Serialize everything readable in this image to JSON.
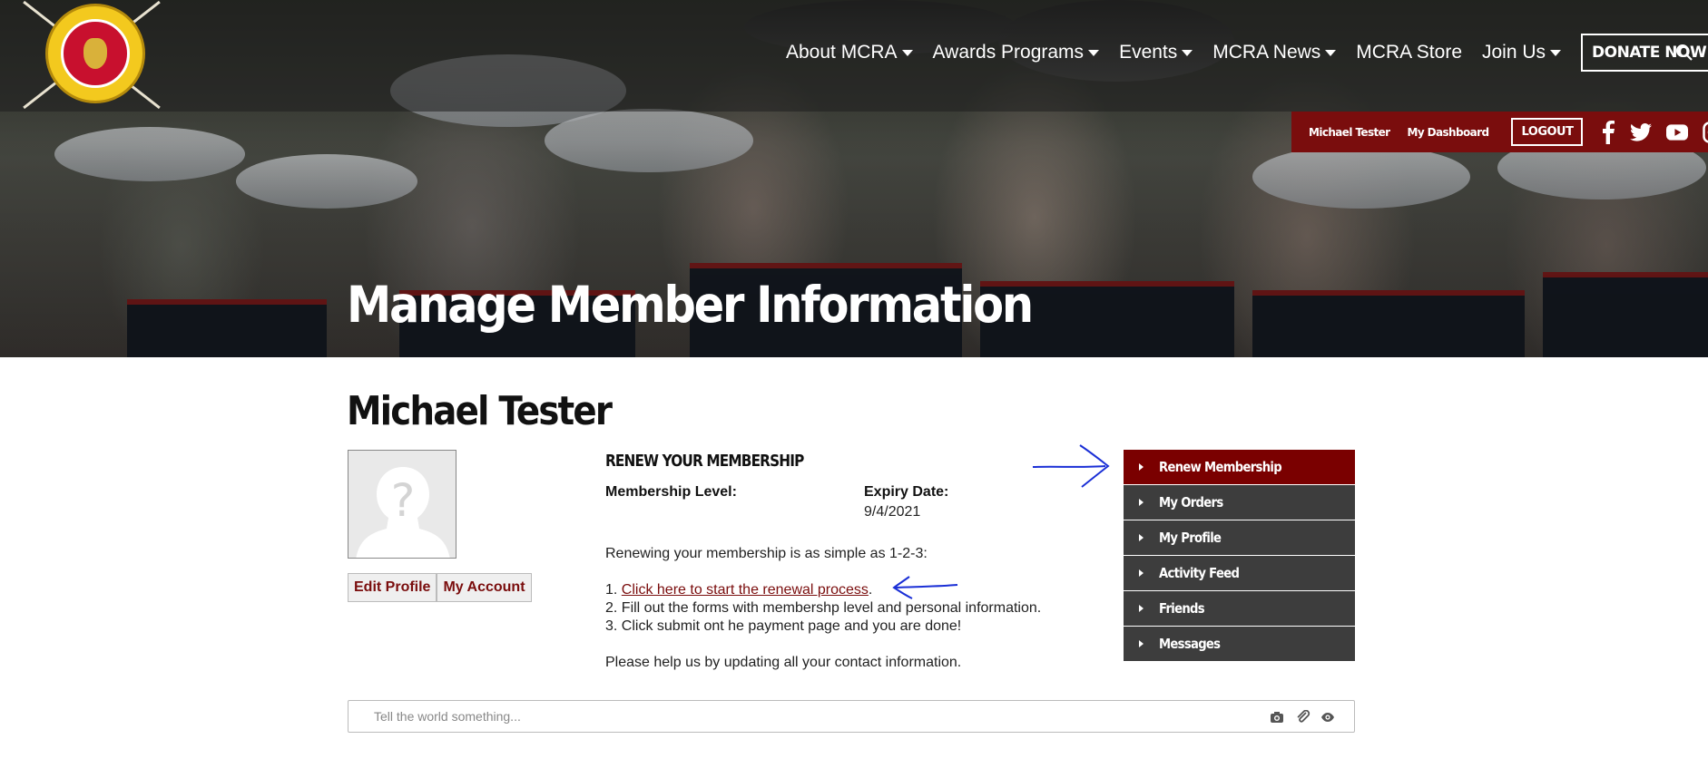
{
  "header": {
    "nav": [
      {
        "label": "About MCRA",
        "has_dropdown": true
      },
      {
        "label": "Awards Programs",
        "has_dropdown": true
      },
      {
        "label": "Events",
        "has_dropdown": true
      },
      {
        "label": "MCRA News",
        "has_dropdown": true
      },
      {
        "label": "MCRA Store",
        "has_dropdown": false
      },
      {
        "label": "Join Us",
        "has_dropdown": true
      }
    ],
    "donate_label": "DONATE NOW",
    "search_icon": "search-icon"
  },
  "userbar": {
    "user_name": "Michael Tester",
    "dashboard_label": "My Dashboard",
    "logout_label": "LOGOUT",
    "social": [
      "facebook-icon",
      "twitter-icon",
      "youtube-icon",
      "instagram-icon"
    ]
  },
  "hero": {
    "title": "Manage Member Information"
  },
  "profile": {
    "name": "Michael Tester",
    "edit_profile_label": "Edit Profile",
    "my_account_label": "My Account"
  },
  "renewal": {
    "heading": "RENEW YOUR MEMBERSHIP",
    "level_label": "Membership Level:",
    "level_value": "",
    "expiry_label": "Expiry Date:",
    "expiry_value": "9/4/2021",
    "intro": "Renewing your membership is as simple as 1-2-3:",
    "step1_prefix": "1. ",
    "step1_link": "Click here to start the renewal process",
    "step1_suffix": ".",
    "step2": "2. Fill out the forms with membershp level and personal information.",
    "step3": "3. Click submit ont he payment page and you are done!",
    "footer": "Please help us by updating all your contact information."
  },
  "menu": [
    {
      "label": "Renew Membership",
      "active": true
    },
    {
      "label": "My Orders",
      "active": false
    },
    {
      "label": "My Profile",
      "active": false
    },
    {
      "label": "Activity Feed",
      "active": false
    },
    {
      "label": "Friends",
      "active": false
    },
    {
      "label": "Messages",
      "active": false
    }
  ],
  "status": {
    "placeholder": "Tell the world something...",
    "icons": [
      "camera-icon",
      "paperclip-icon",
      "eye-icon"
    ]
  },
  "colors": {
    "brand_red": "#7a0d0d",
    "menu_gray": "#3d3d3d",
    "menu_active": "#7a0000",
    "annotation_blue": "#1a2fd6"
  }
}
